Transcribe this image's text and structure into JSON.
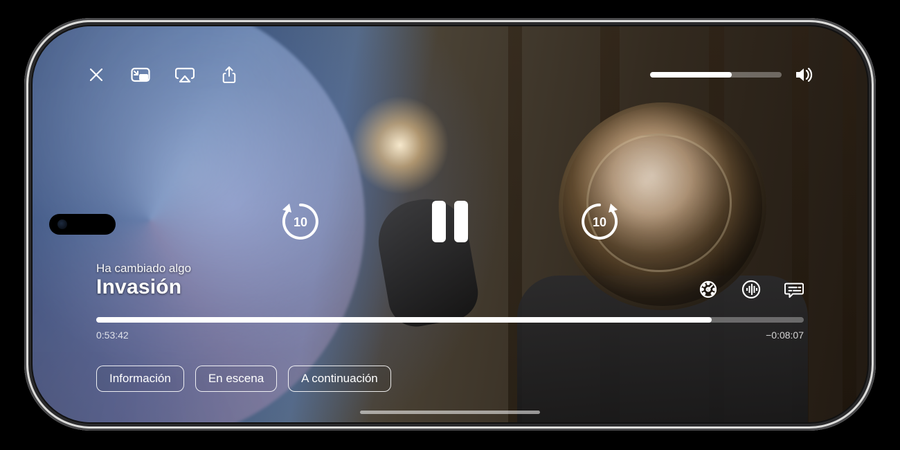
{
  "episode_title": "Ha cambiado algo",
  "series_title": "Invasión",
  "elapsed_time": "0:53:42",
  "remaining_time": "−0:08:07",
  "progress_percent": 87,
  "volume_percent": 62,
  "skip_seconds_label": "10",
  "tabs": {
    "info": "Información",
    "in_scene": "En escena",
    "up_next": "A continuación"
  }
}
